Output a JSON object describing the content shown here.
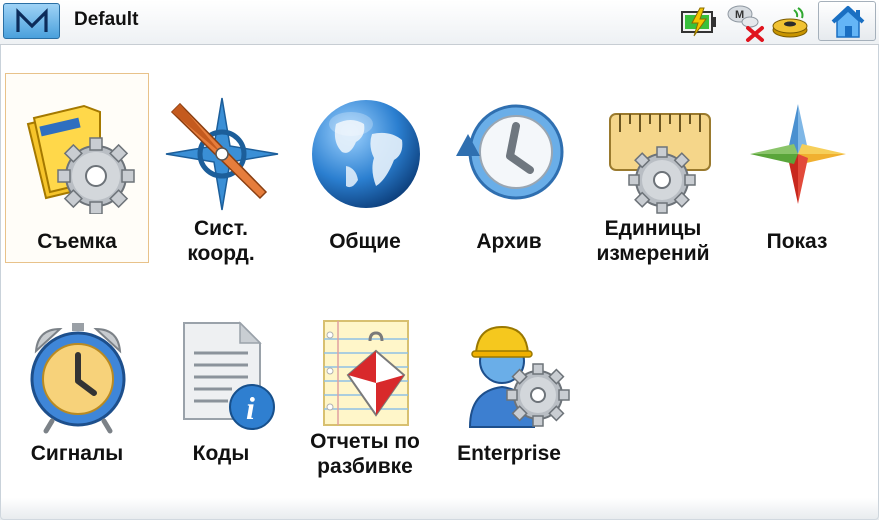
{
  "header": {
    "logo_icon": "m-logo-icon",
    "profile_name": "Default",
    "status_icons": [
      "battery-charging-icon",
      "radio-disconnected-icon",
      "gnss-receiver-icon"
    ],
    "home_icon": "home-icon"
  },
  "tiles": [
    {
      "label": "Съемка",
      "icon": "survey-folder-gear-icon",
      "selected": true
    },
    {
      "label": "Сист. коорд.",
      "icon": "compass-icon"
    },
    {
      "label": "Общие",
      "icon": "globe-icon"
    },
    {
      "label": "Архив",
      "icon": "clock-history-icon"
    },
    {
      "label": "Единицы измерений",
      "icon": "ruler-gear-icon"
    },
    {
      "label": "Показ",
      "icon": "star-display-icon"
    },
    {
      "label": "Сигналы",
      "icon": "alarm-clock-icon"
    },
    {
      "label": "Коды",
      "icon": "document-info-icon"
    },
    {
      "label": "Отчеты по разбивке",
      "icon": "stakeout-report-icon"
    },
    {
      "label": "Enterprise",
      "icon": "worker-gear-icon"
    }
  ],
  "colors": {
    "selection_border": "#e8c28a",
    "logo_blue": "#4aa0dc"
  }
}
